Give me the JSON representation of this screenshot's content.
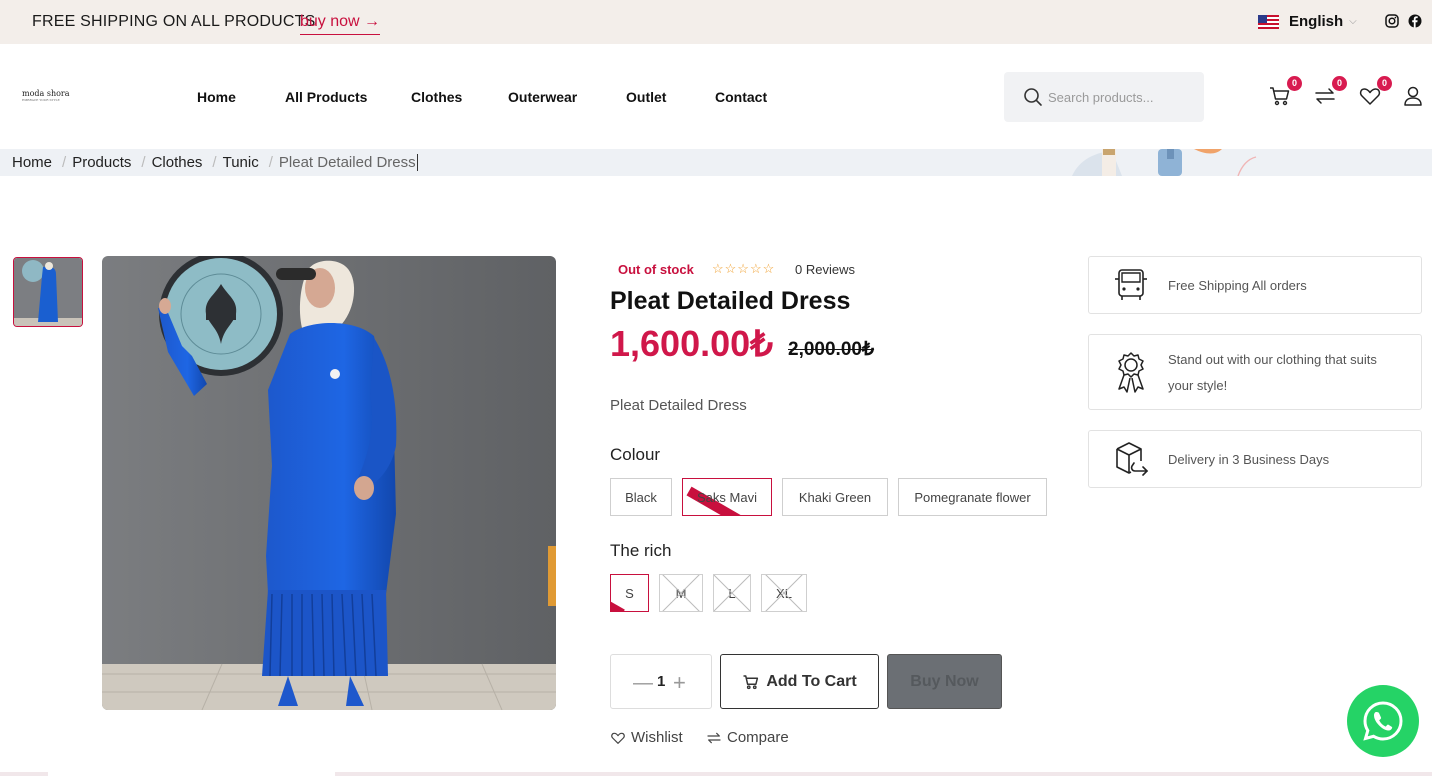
{
  "topbar": {
    "promo": "FREE SHIPPING ON ALL PRODUCTS",
    "buy_now": "buy now →",
    "language": "English"
  },
  "header": {
    "logo": "moda shora",
    "logo_tagline": "EMBRACE YOUR STYLE",
    "nav": [
      "Home",
      "All Products",
      "Clothes",
      "Outerwear",
      "Outlet",
      "Contact"
    ],
    "search_placeholder": "Search products...",
    "cart_count": "0",
    "compare_count": "0",
    "wishlist_count": "0"
  },
  "breadcrumb": [
    "Home",
    "Products",
    "Clothes",
    "Tunic",
    "Pleat Detailed Dress"
  ],
  "product": {
    "stock_status": "Out of stock",
    "stars": "☆☆☆☆☆",
    "reviews": "0 Reviews",
    "title": "Pleat Detailed Dress",
    "price": "1,600.00₺",
    "old_price": "2,000.00₺",
    "description": "Pleat Detailed Dress",
    "colour_label": "Colour",
    "colours": [
      "Black",
      "Saks Mavi",
      "Khaki Green",
      "Pomegranate flower"
    ],
    "size_label": "The rich",
    "sizes": [
      "S",
      "M",
      "L",
      "XL"
    ],
    "quantity": "1",
    "add_to_cart": "Add To Cart",
    "buy_now": "Buy Now",
    "wishlist": "Wishlist",
    "compare": "Compare"
  },
  "features": [
    "Free Shipping All orders",
    "Stand out with our clothing that suits your style!",
    "Delivery in 3 Business Days"
  ],
  "colors": {
    "accent": "#c8103e",
    "price": "#d0174a",
    "topbar_bg": "#f3eeea",
    "whatsapp": "#25d366"
  }
}
